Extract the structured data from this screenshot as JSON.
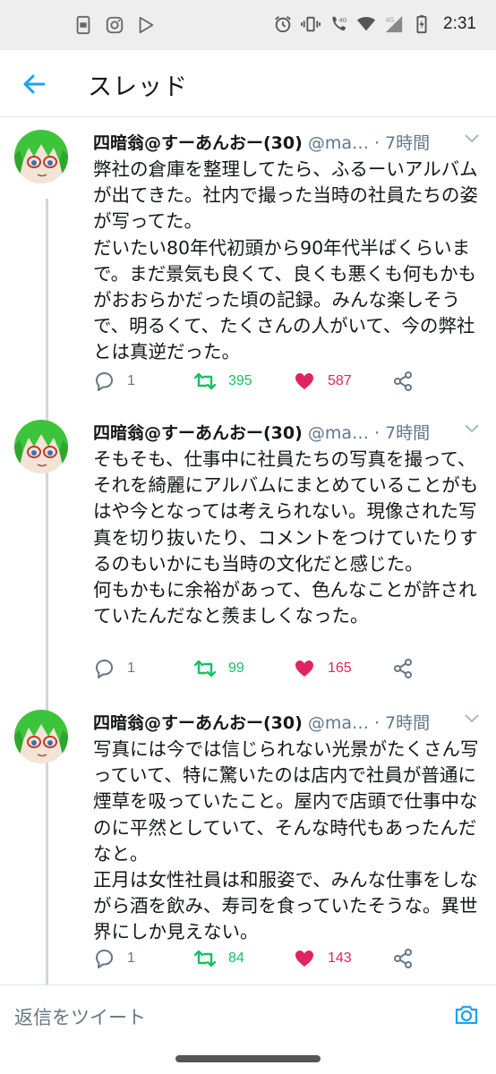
{
  "status_bar": {
    "time": "2:31",
    "network": "4G",
    "network2": "4G",
    "icons_left": [
      "phone-alert-icon",
      "instagram-icon",
      "play-store-icon"
    ],
    "icons_right": [
      "alarm-icon",
      "vibrate-icon",
      "wifi-calling-icon",
      "wifi-icon",
      "signal-icon",
      "battery-charging-icon"
    ]
  },
  "header": {
    "back_icon": "back-arrow-icon",
    "title": "スレッド"
  },
  "colors": {
    "accent": "#1da1f2",
    "retweet": "#17bf63",
    "like": "#e0245e",
    "muted": "#657786"
  },
  "tweets": [
    {
      "author": "四暗翁@すーあんおー(30)",
      "handle": "@ma…",
      "time": "· 7時間",
      "text": "弊社の倉庫を整理してたら、ふるーいアルバムが出てきた。社内で撮った当時の社員たちの姿が写ってた。\nだいたい80年代初頭から90年代半ばくらいまで。まだ景気も良くて、良くも悪くも何もかもがおおらかだった頃の記録。みんな楽しそうで、明るくて、たくさんの人がいて、今の弊社とは真逆だった。",
      "replies": "1",
      "retweets": "395",
      "likes": "587"
    },
    {
      "author": "四暗翁@すーあんおー(30)",
      "handle": "@ma…",
      "time": "· 7時間",
      "text": "そもそも、仕事中に社員たちの写真を撮って、それを綺麗にアルバムにまとめていることがもはや今となっては考えられない。現像された写真を切り抜いたり、コメントをつけていたりするのもいかにも当時の文化だと感じた。\n何もかもに余裕があって、色んなことが許されていたんだなと羨ましくなった。",
      "replies": "1",
      "retweets": "99",
      "likes": "165"
    },
    {
      "author": "四暗翁@すーあんおー(30)",
      "handle": "@ma…",
      "time": "· 7時間",
      "text": "写真には今では信じられない光景がたくさん写っていて、特に驚いたのは店内で社員が普通に煙草を吸っていたこと。屋内で店頭で仕事中なのに平然としていて、そんな時代もあったんだなと。\n正月は女性社員は和服姿で、みんな仕事をしながら酒を飲み、寿司を食っていたそうな。異世界にしか見えない。",
      "replies": "1",
      "retweets": "84",
      "likes": "143"
    }
  ],
  "reply_bar": {
    "placeholder": "返信をツイート",
    "camera_icon": "camera-icon"
  }
}
